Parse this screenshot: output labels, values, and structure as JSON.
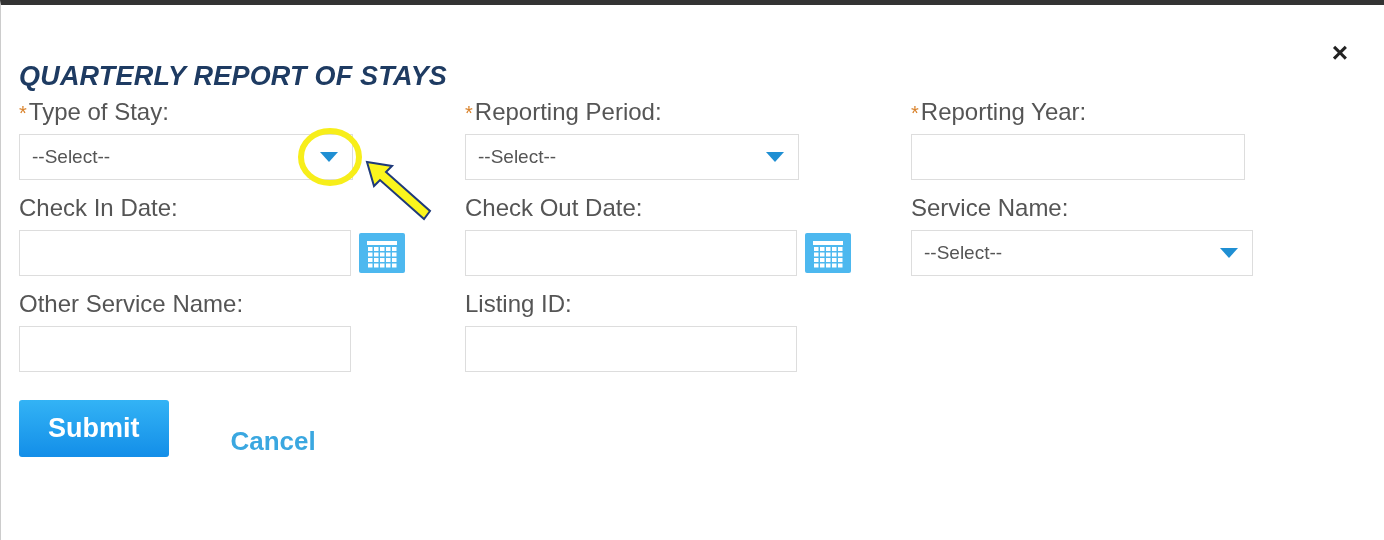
{
  "dialog": {
    "title": "QUARTERLY REPORT OF STAYS",
    "close": "×"
  },
  "fields": [
    {
      "kind": "select",
      "label": "Type of Stay:",
      "required": true,
      "value": "--Select--",
      "highlighted": true
    },
    {
      "kind": "select",
      "label": "Reporting Period:",
      "required": true,
      "value": "--Select--",
      "highlighted": false
    },
    {
      "kind": "text",
      "label": "Reporting Year:",
      "required": true,
      "highlighted": false
    },
    {
      "kind": "date",
      "label": "Check In Date:",
      "required": false,
      "highlighted": false
    },
    {
      "kind": "date",
      "label": "Check Out Date:",
      "required": false,
      "highlighted": false
    },
    {
      "kind": "select",
      "label": "Service Name:",
      "required": false,
      "value": "--Select--",
      "highlighted": false
    },
    {
      "kind": "text",
      "label": "Other Service Name:",
      "required": false,
      "highlighted": false
    },
    {
      "kind": "text",
      "label": "Listing ID:",
      "required": false,
      "highlighted": false
    }
  ],
  "buttons": {
    "submit": "Submit",
    "cancel": "Cancel"
  },
  "required_mark": "*"
}
